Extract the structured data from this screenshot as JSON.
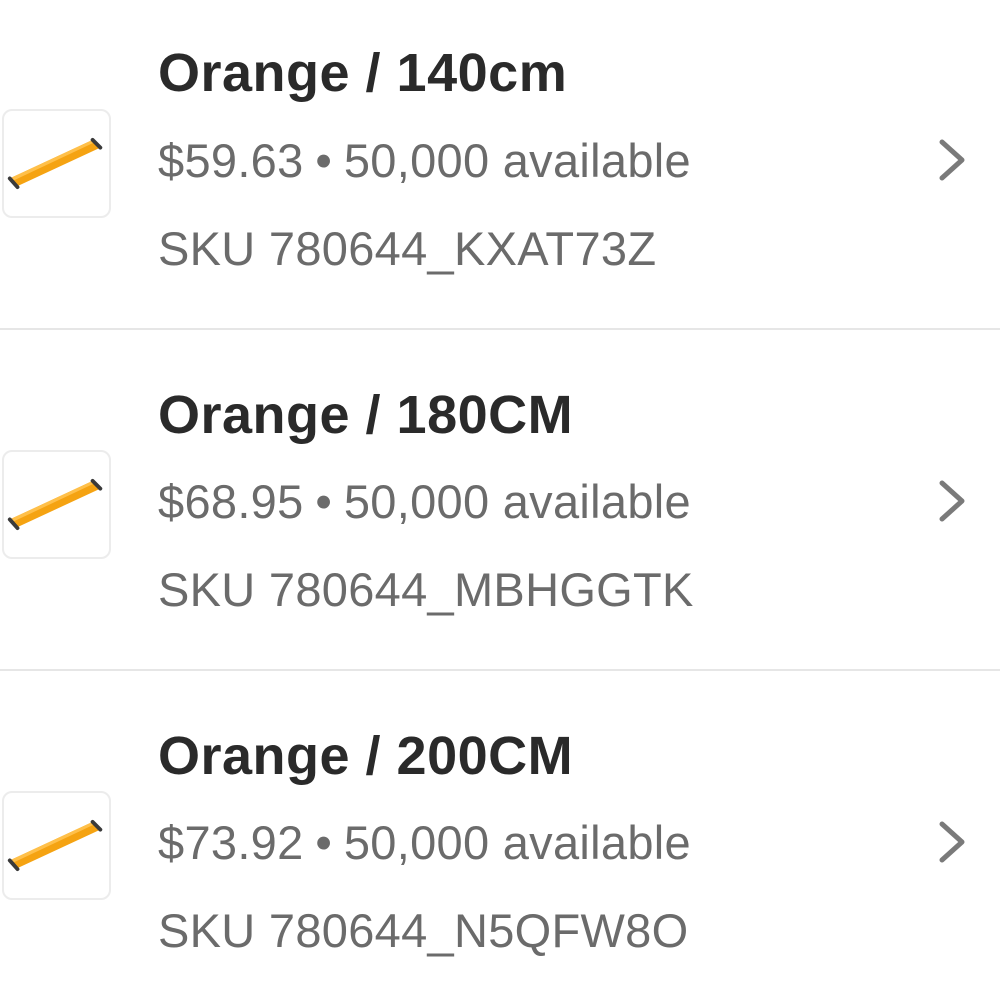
{
  "variants": [
    {
      "title": "Orange / 140cm",
      "price": "$59.63",
      "separator": "•",
      "availability": "50,000 available",
      "sku": "SKU 780644_KXAT73Z",
      "thumbnail_icon": "orange-slide-board-icon"
    },
    {
      "title": "Orange / 180CM",
      "price": "$68.95",
      "separator": "•",
      "availability": "50,000 available",
      "sku": "SKU 780644_MBHGGTK",
      "thumbnail_icon": "orange-slide-board-icon"
    },
    {
      "title": "Orange / 200CM",
      "price": "$73.92",
      "separator": "•",
      "availability": "50,000 available",
      "sku": "SKU 780644_N5QFW8O",
      "thumbnail_icon": "orange-slide-board-icon"
    }
  ],
  "colors": {
    "title_text": "#2a2a2a",
    "secondary_text": "#6b6b6b",
    "divider": "#e6e6e6",
    "thumbnail_accent": "#f5a312"
  },
  "row_action_icon": "chevron-right-icon"
}
